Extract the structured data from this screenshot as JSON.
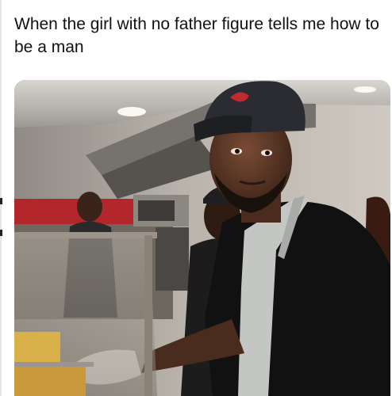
{
  "post": {
    "caption": "When the girl with no father figure tells me how to be a man"
  },
  "image": {
    "subject": "man-in-cap-and-apron-at-food-counter"
  },
  "colors": {
    "text": "#111111",
    "background": "#ffffff",
    "kitchen_wall": "#a9a39b",
    "cap": "#2a2c31",
    "apron": "#c7c9c6"
  }
}
